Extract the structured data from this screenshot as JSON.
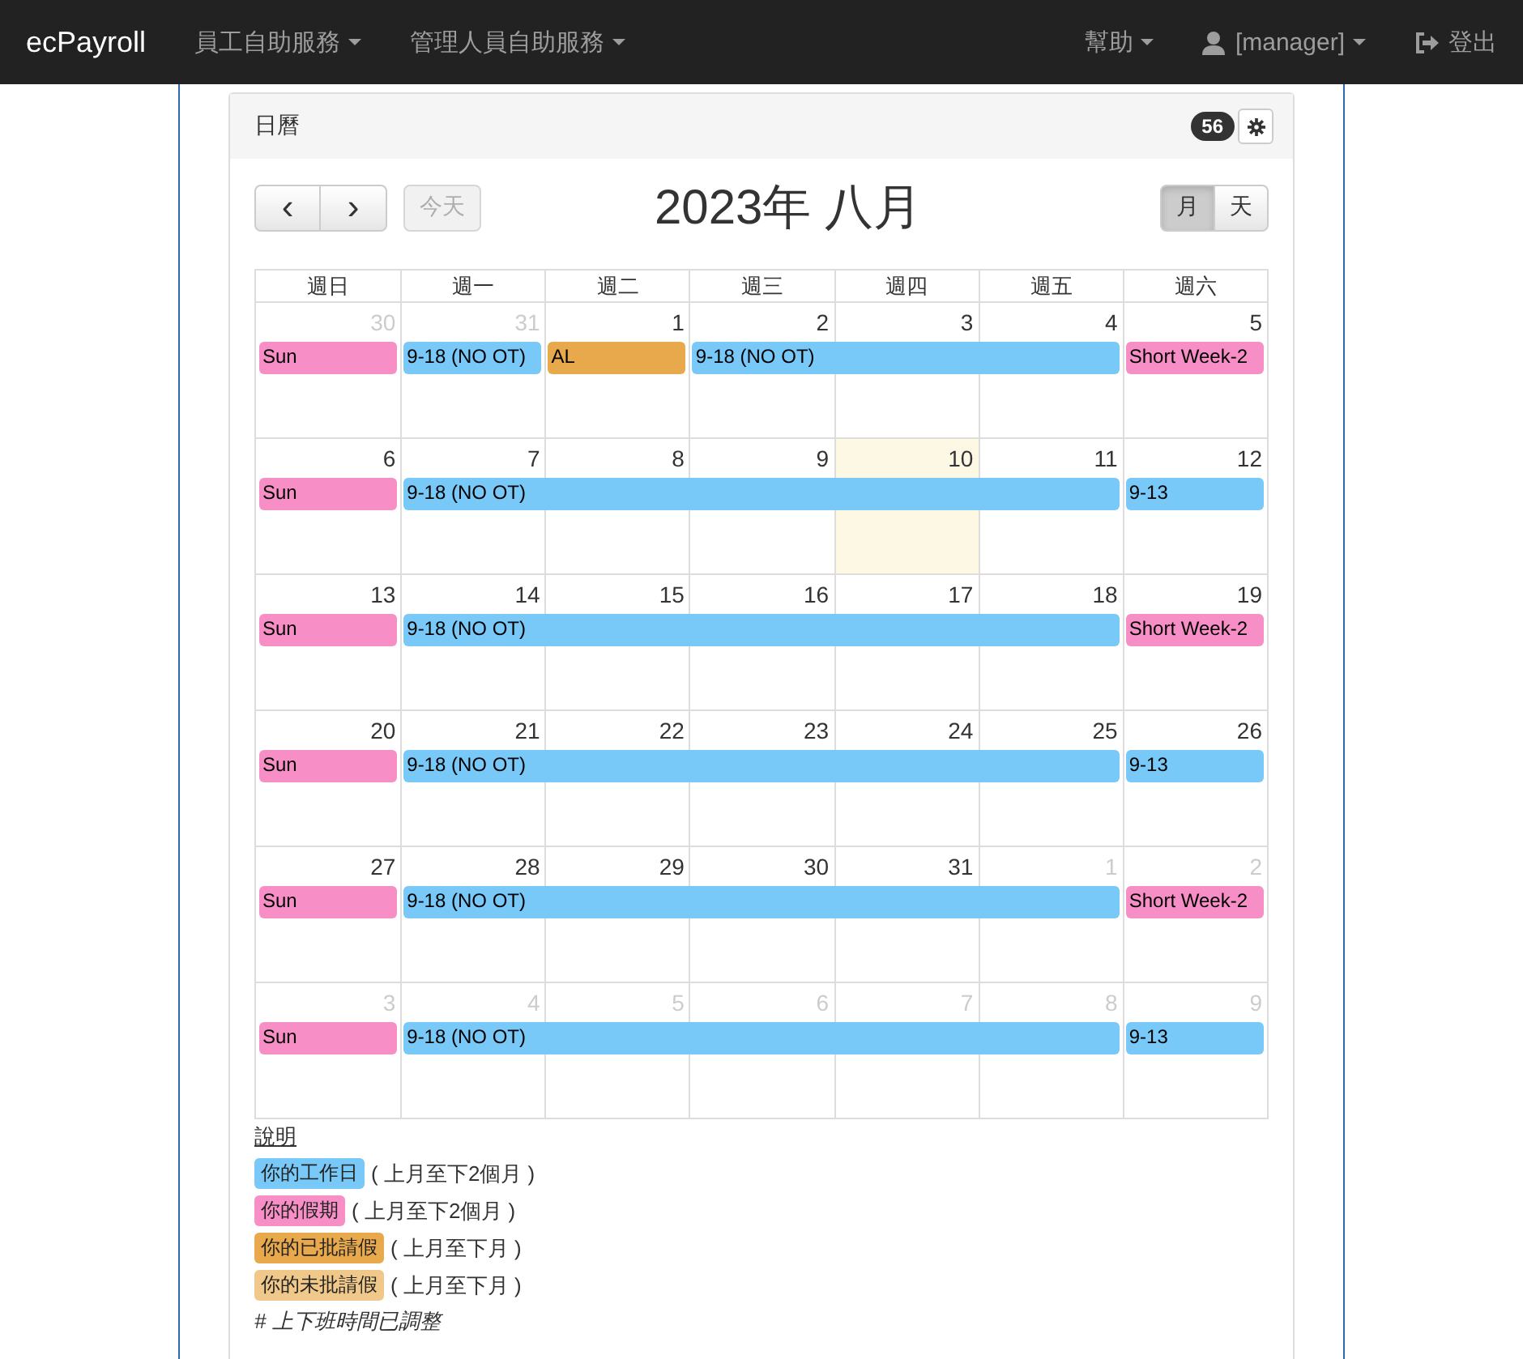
{
  "navbar": {
    "brand": "ecPayroll",
    "menus": [
      {
        "label": "員工自助服務",
        "kind": "dropdown"
      },
      {
        "label": "管理人員自助服務",
        "kind": "dropdown"
      }
    ],
    "right": [
      {
        "label": "幫助",
        "kind": "dropdown"
      },
      {
        "label": "[manager]",
        "kind": "user"
      },
      {
        "label": "登出",
        "kind": "logout"
      }
    ]
  },
  "panel": {
    "title": "日曆",
    "badge": "56"
  },
  "toolbar": {
    "prev": "‹",
    "next": "›",
    "today": "今天",
    "title": "2023年 八月",
    "views": [
      {
        "label": "月",
        "selected": true
      },
      {
        "label": "天",
        "selected": false
      }
    ]
  },
  "calendar": {
    "weekdays": [
      "週日",
      "週一",
      "週二",
      "週三",
      "週四",
      "週五",
      "週六"
    ],
    "weeks": [
      {
        "days": [
          {
            "number": "30",
            "other_month": true,
            "today": false,
            "event": {
              "title": "Sun",
              "color": "#f78fc6"
            }
          },
          {
            "number": "31",
            "other_month": true,
            "today": false,
            "event": {
              "title": "9-18 (NO OT)",
              "color": "#78c8f8"
            }
          },
          {
            "number": "1",
            "other_month": false,
            "today": false,
            "event": {
              "title": "AL",
              "color": "#e8a94c"
            }
          },
          {
            "number": "2",
            "other_month": false,
            "today": false,
            "event": {
              "title": "9-18 (NO OT)",
              "color": "#78c8f8"
            }
          },
          {
            "number": "3",
            "other_month": false,
            "today": false,
            "continued": true
          },
          {
            "number": "4",
            "other_month": false,
            "today": false,
            "continued": true
          },
          {
            "number": "5",
            "other_month": false,
            "today": false,
            "event": {
              "title": "Short Week-2",
              "color": "#f78fc6"
            }
          }
        ]
      },
      {
        "days": [
          {
            "number": "6",
            "other_month": false,
            "today": false,
            "event": {
              "title": "Sun",
              "color": "#f78fc6"
            }
          },
          {
            "number": "7",
            "other_month": false,
            "today": false,
            "event": {
              "title": "9-18 (NO OT)",
              "color": "#78c8f8"
            }
          },
          {
            "number": "8",
            "other_month": false,
            "today": false,
            "continued": true
          },
          {
            "number": "9",
            "other_month": false,
            "today": false,
            "continued": true
          },
          {
            "number": "10",
            "other_month": false,
            "today": true,
            "continued": true
          },
          {
            "number": "11",
            "other_month": false,
            "today": false,
            "continued": true
          },
          {
            "number": "12",
            "other_month": false,
            "today": false,
            "event": {
              "title": "9-13",
              "color": "#78c8f8"
            }
          }
        ]
      },
      {
        "days": [
          {
            "number": "13",
            "other_month": false,
            "today": false,
            "event": {
              "title": "Sun",
              "color": "#f78fc6"
            }
          },
          {
            "number": "14",
            "other_month": false,
            "today": false,
            "event": {
              "title": "9-18 (NO OT)",
              "color": "#78c8f8"
            }
          },
          {
            "number": "15",
            "other_month": false,
            "today": false,
            "continued": true
          },
          {
            "number": "16",
            "other_month": false,
            "today": false,
            "continued": true
          },
          {
            "number": "17",
            "other_month": false,
            "today": false,
            "continued": true
          },
          {
            "number": "18",
            "other_month": false,
            "today": false,
            "continued": true
          },
          {
            "number": "19",
            "other_month": false,
            "today": false,
            "event": {
              "title": "Short Week-2",
              "color": "#f78fc6"
            }
          }
        ]
      },
      {
        "days": [
          {
            "number": "20",
            "other_month": false,
            "today": false,
            "event": {
              "title": "Sun",
              "color": "#f78fc6"
            }
          },
          {
            "number": "21",
            "other_month": false,
            "today": false,
            "event": {
              "title": "9-18 (NO OT)",
              "color": "#78c8f8"
            }
          },
          {
            "number": "22",
            "other_month": false,
            "today": false,
            "continued": true
          },
          {
            "number": "23",
            "other_month": false,
            "today": false,
            "continued": true
          },
          {
            "number": "24",
            "other_month": false,
            "today": false,
            "continued": true
          },
          {
            "number": "25",
            "other_month": false,
            "today": false,
            "continued": true
          },
          {
            "number": "26",
            "other_month": false,
            "today": false,
            "event": {
              "title": "9-13",
              "color": "#78c8f8"
            }
          }
        ]
      },
      {
        "days": [
          {
            "number": "27",
            "other_month": false,
            "today": false,
            "event": {
              "title": "Sun",
              "color": "#f78fc6"
            }
          },
          {
            "number": "28",
            "other_month": false,
            "today": false,
            "event": {
              "title": "9-18 (NO OT)",
              "color": "#78c8f8"
            }
          },
          {
            "number": "29",
            "other_month": false,
            "today": false,
            "continued": true
          },
          {
            "number": "30",
            "other_month": false,
            "today": false,
            "continued": true
          },
          {
            "number": "31",
            "other_month": false,
            "today": false,
            "continued": true
          },
          {
            "number": "1",
            "other_month": true,
            "today": false,
            "continued": true
          },
          {
            "number": "2",
            "other_month": true,
            "today": false,
            "event": {
              "title": "Short Week-2",
              "color": "#f78fc6"
            }
          }
        ]
      },
      {
        "days": [
          {
            "number": "3",
            "other_month": true,
            "today": false,
            "event": {
              "title": "Sun",
              "color": "#f78fc6"
            }
          },
          {
            "number": "4",
            "other_month": true,
            "today": false,
            "event": {
              "title": "9-18 (NO OT)",
              "color": "#78c8f8"
            }
          },
          {
            "number": "5",
            "other_month": true,
            "today": false,
            "continued": true
          },
          {
            "number": "6",
            "other_month": true,
            "today": false,
            "continued": true
          },
          {
            "number": "7",
            "other_month": true,
            "today": false,
            "continued": true
          },
          {
            "number": "8",
            "other_month": true,
            "today": false,
            "continued": true
          },
          {
            "number": "9",
            "other_month": true,
            "today": false,
            "event": {
              "title": "9-13",
              "color": "#78c8f8"
            }
          }
        ]
      }
    ]
  },
  "legend": {
    "title": "說明",
    "items": [
      {
        "label": "你的工作日",
        "note": "( 上月至下2個月 )",
        "color": "#78c8f8"
      },
      {
        "label": "你的假期",
        "note": "( 上月至下2個月 )",
        "color": "#f78fc6"
      },
      {
        "label": "你的已批請假",
        "note": "( 上月至下月 )",
        "color": "#e8a94c"
      },
      {
        "label": "你的未批請假",
        "note": "( 上月至下月 )",
        "color": "#f0c98a"
      }
    ],
    "footnote": "# 上下班時間已調整"
  }
}
